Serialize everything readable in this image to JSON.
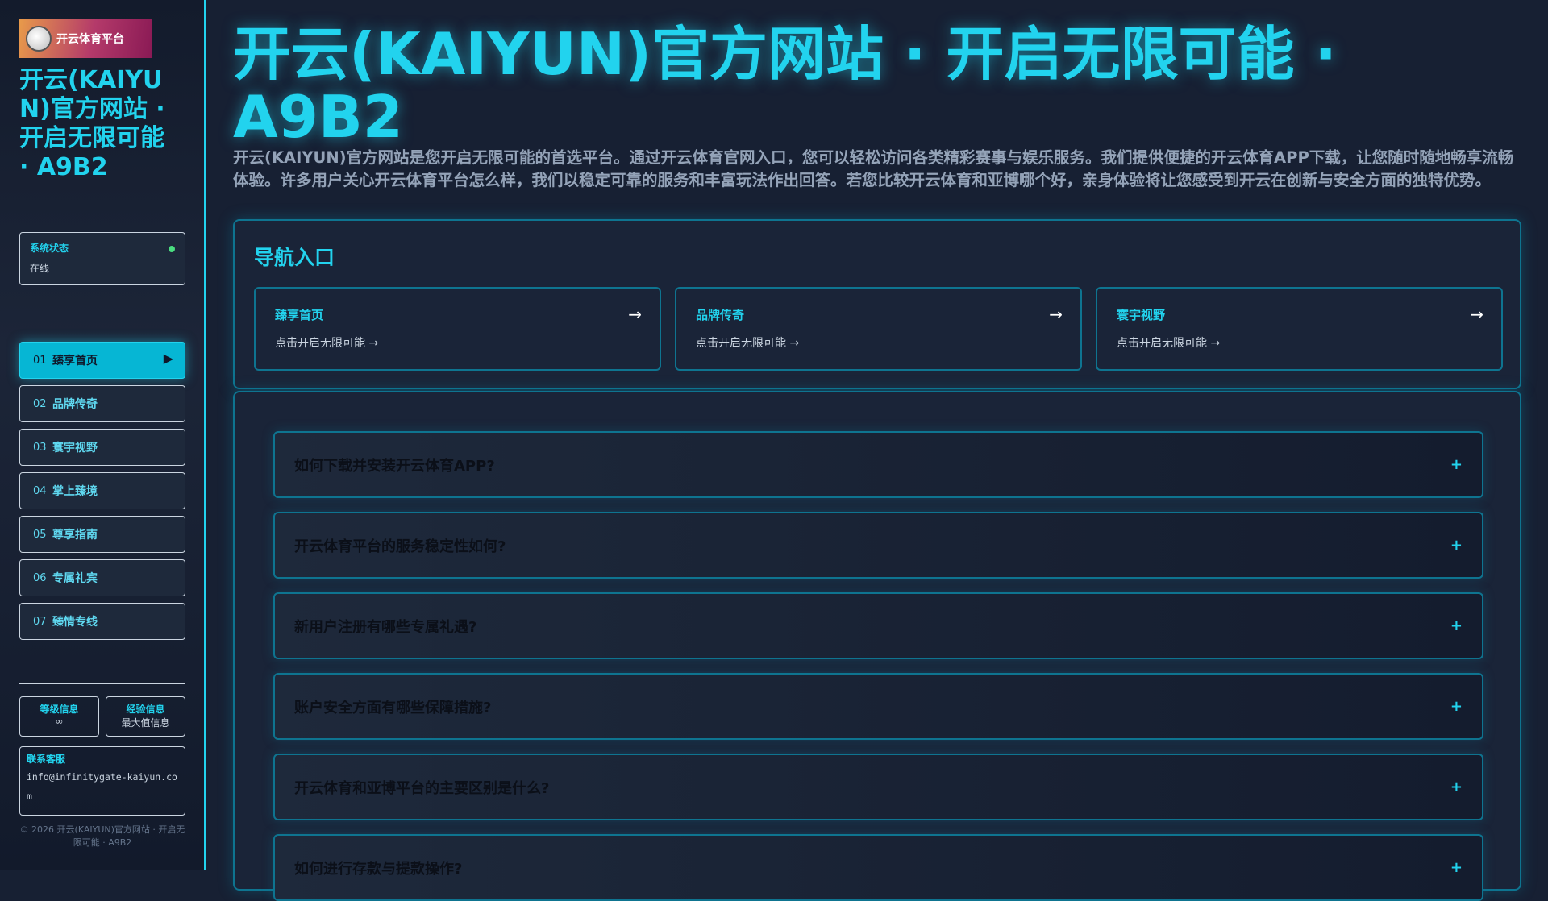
{
  "sidebar": {
    "logo_text": "开云体育平台",
    "title": "开云(KAIYUN)官方网站 · 开启无限可能 · A9B2",
    "status": {
      "label": "系统状态",
      "value": "在线"
    },
    "nav": [
      {
        "num": "01",
        "label": "臻享首页"
      },
      {
        "num": "02",
        "label": "品牌传奇"
      },
      {
        "num": "03",
        "label": "寰宇视野"
      },
      {
        "num": "04",
        "label": "掌上臻境"
      },
      {
        "num": "05",
        "label": "尊享指南"
      },
      {
        "num": "06",
        "label": "专属礼宾"
      },
      {
        "num": "07",
        "label": "臻情专线"
      }
    ],
    "level": {
      "label": "等级信息",
      "value": "∞"
    },
    "exp": {
      "label": "经验信息",
      "value": "最大值信息"
    },
    "contact": {
      "label": "联系客服",
      "email": "info@infinitygate-kaiyun.com"
    },
    "footer": "© 2026 开云(KAIYUN)官方网站 · 开启无限可能 · A9B2"
  },
  "main": {
    "title": "开云(KAIYUN)官方网站 · 开启无限可能 · A9B2",
    "intro": "开云(KAIYUN)官方网站是您开启无限可能的首选平台。通过开云体育官网入口，您可以轻松访问各类精彩赛事与娱乐服务。我们提供便捷的开云体育APP下载，让您随时随地畅享流畅体验。许多用户关心开云体育平台怎么样，我们以稳定可靠的服务和丰富玩法作出回答。若您比较开云体育和亚博哪个好，亲身体验将让您感受到开云在创新与安全方面的独特优势。",
    "nav_heading": "导航入口",
    "cards": [
      {
        "title": "臻享首页",
        "sub": "点击开启无限可能 →"
      },
      {
        "title": "品牌传奇",
        "sub": "点击开启无限可能 →"
      },
      {
        "title": "寰宇视野",
        "sub": "点击开启无限可能 →"
      }
    ],
    "faq": [
      "如何下载并安装开云体育APP?",
      "开云体育平台的服务稳定性如何?",
      "新用户注册有哪些专属礼遇?",
      "账户安全方面有哪些保障措施?",
      "开云体育和亚博平台的主要区别是什么?",
      "如何进行存款与提款操作?"
    ],
    "faq_toggle": "+",
    "arrow": "→"
  }
}
